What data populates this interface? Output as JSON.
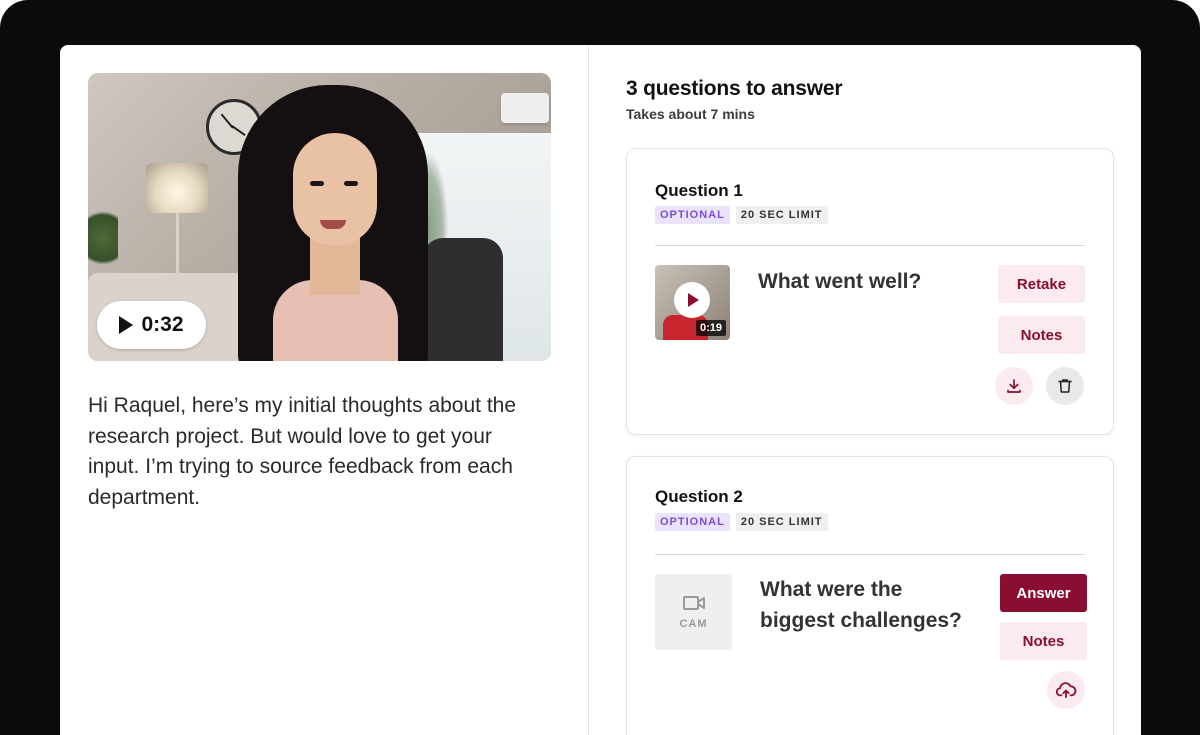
{
  "video": {
    "duration": "0:32"
  },
  "message": "Hi Raquel, here’s my initial thoughts about the research project. But would love to get your input. I’m trying to source feedback from each department.",
  "questions_panel": {
    "title": "3 questions to answer",
    "subtitle": "Takes about 7 mins"
  },
  "questions": [
    {
      "label": "Question 1",
      "optional_badge": "OPTIONAL",
      "limit_badge": "20 SEC LIMIT",
      "text": "What went well?",
      "thumbnail_time": "0:19",
      "primary_button": "Retake",
      "notes_button": "Notes",
      "icons": [
        "download-icon",
        "trash-icon"
      ]
    },
    {
      "label": "Question 2",
      "optional_badge": "OPTIONAL",
      "limit_badge": "20 SEC LIMIT",
      "text": "What were the biggest challenges?",
      "cam_label": "CAM",
      "primary_button": "Answer",
      "notes_button": "Notes",
      "icons": [
        "video-camera-icon",
        "cloud-upload-icon"
      ]
    }
  ],
  "colors": {
    "accent": "#8a0e32",
    "accent_soft": "#fbeaee",
    "optional_badge_bg": "#ebe2fb",
    "optional_badge_text": "#7a4fd6",
    "frame": "#0b0b0b"
  }
}
